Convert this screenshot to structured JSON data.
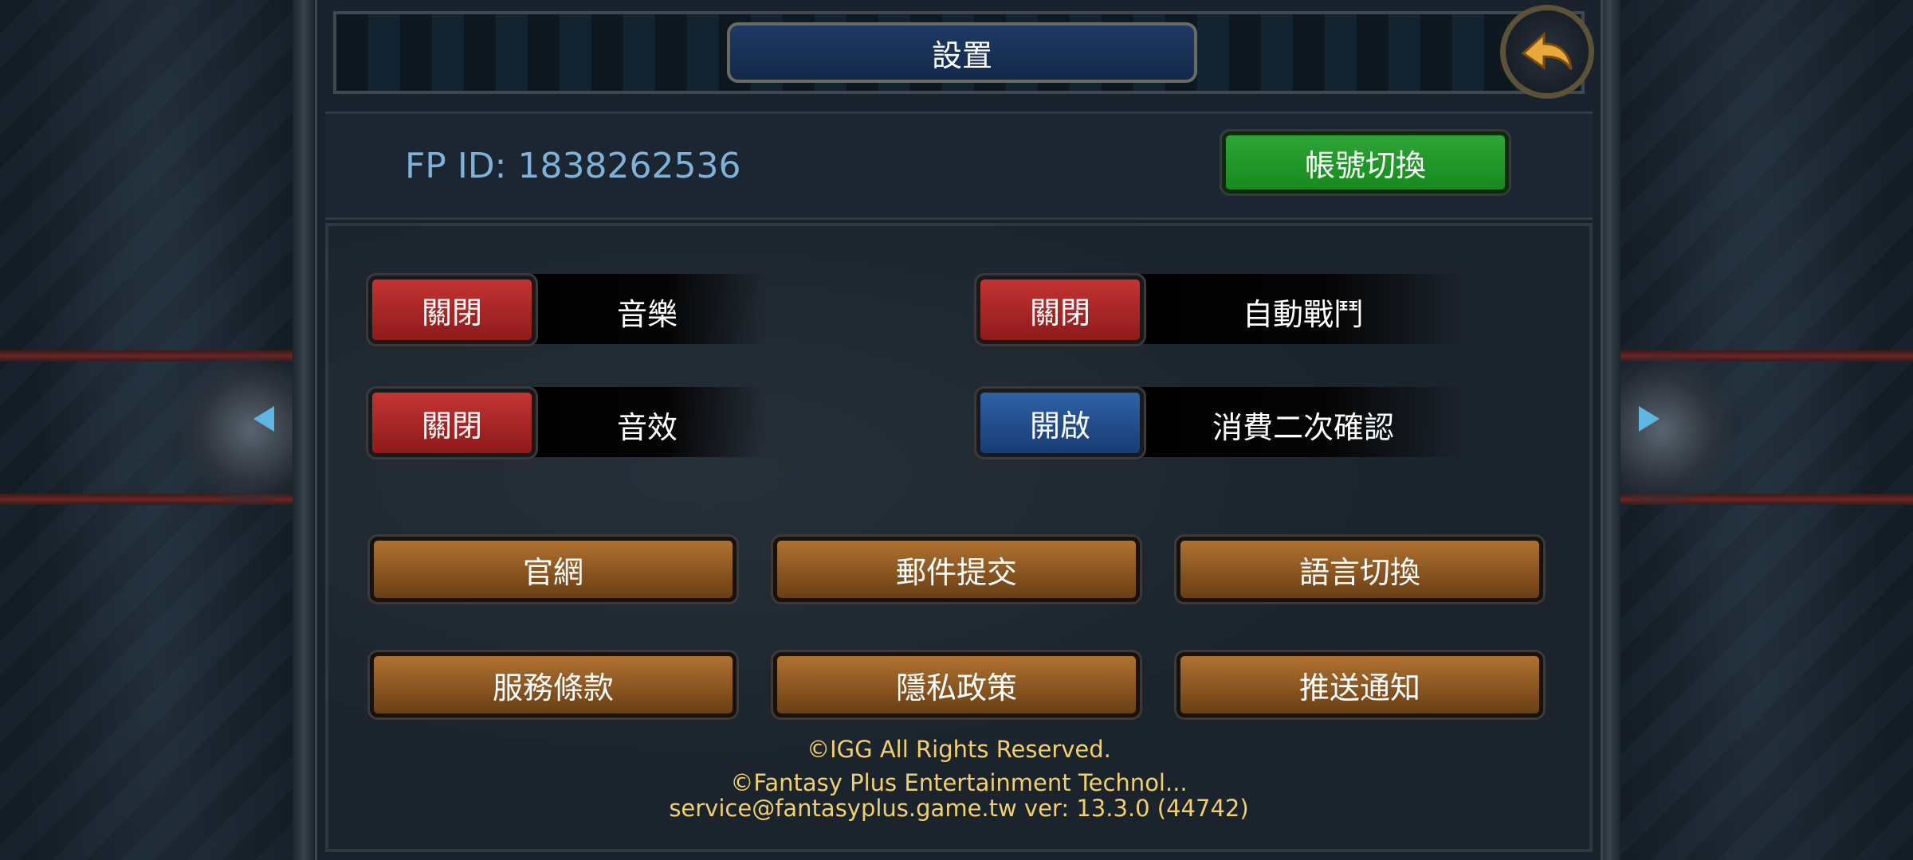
{
  "header": {
    "title": "設置"
  },
  "account": {
    "fp_id": "FP ID: 1838262536",
    "switch_label": "帳號切換"
  },
  "toggles": [
    {
      "state": "關閉",
      "label": "音樂"
    },
    {
      "state": "關閉",
      "label": "自動戰鬥"
    },
    {
      "state": "關閉",
      "label": "音效"
    },
    {
      "state": "開啟",
      "label": "消費二次確認"
    }
  ],
  "buttons": [
    "官網",
    "郵件提交",
    "語言切換",
    "服務條款",
    "隱私政策",
    "推送通知"
  ],
  "footer": {
    "line1": "©IGG All Rights Reserved.",
    "line2": "©Fantasy Plus Entertainment Technol...",
    "line3": "service@fantasyplus.game.tw ver: 13.3.0 (44742)"
  },
  "icons": {
    "back": "back-arrow-icon",
    "prev": "triangle-left-icon",
    "next": "triangle-right-icon"
  },
  "colors": {
    "off": "#c43434",
    "on": "#2e62a8",
    "green": "#2ea536",
    "brown": "#b07230",
    "footer": "#f2d06b"
  }
}
